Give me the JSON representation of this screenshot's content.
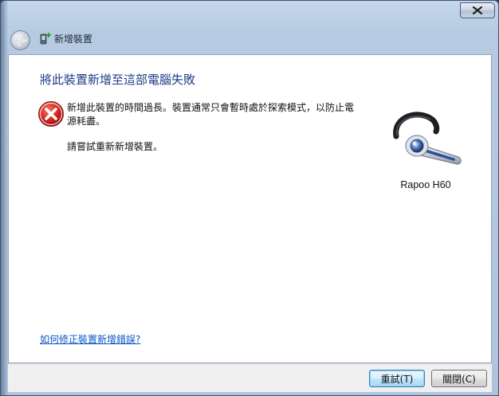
{
  "window": {
    "title": "新增裝置",
    "close_tooltip": "關閉"
  },
  "content": {
    "heading": "將此裝置新增至這部電腦失敗",
    "message": "新增此裝置的時間過長。裝置通常只會暫時處於探索模式，以防止電源耗盡。",
    "retry_instruction": "請嘗試重新新增裝置。",
    "device_name": "Rapoo H60",
    "help_link": "如何修正裝置新增錯誤?"
  },
  "buttons": {
    "retry": "重試(T)",
    "close": "關閉(C)"
  },
  "icons": {
    "back": "back-arrow-icon",
    "title": "add-device-icon",
    "error": "error-icon",
    "device": "bluetooth-headset-icon",
    "window_close": "close-icon"
  },
  "colors": {
    "heading": "#1e3a8a",
    "link": "#0b55c4",
    "error_red": "#c8171a"
  }
}
